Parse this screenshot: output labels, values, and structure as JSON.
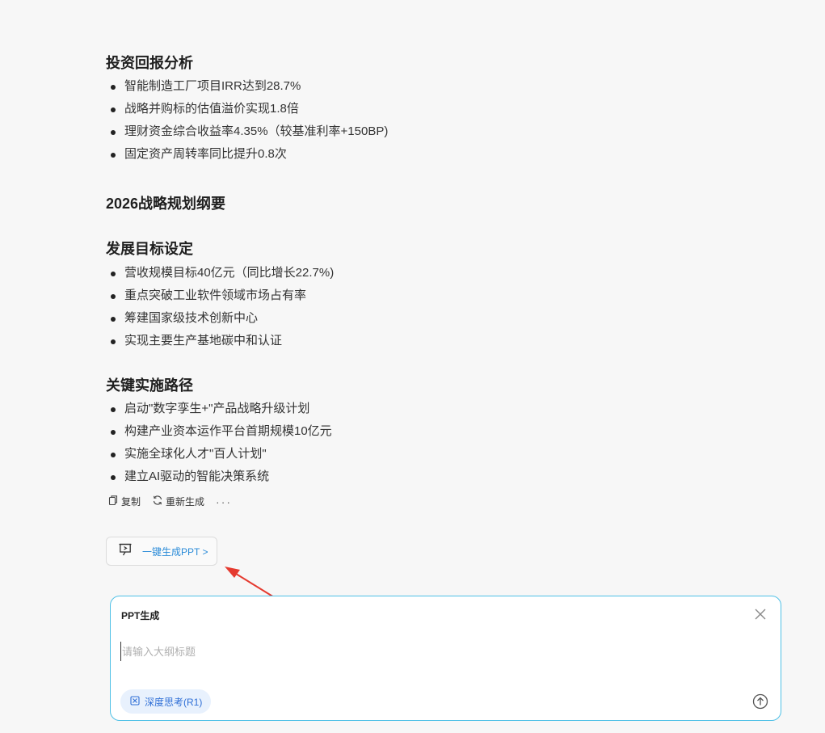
{
  "sections": [
    {
      "title": "投资回报分析",
      "items": [
        "智能制造工厂项目IRR达到28.7%",
        "战略并购标的估值溢价实现1.8倍",
        "理财资金综合收益率4.35%（较基准利率+150BP)",
        "固定资产周转率同比提升0.8次"
      ]
    },
    {
      "title": "2026战略规划纲要",
      "items": []
    },
    {
      "title": "发展目标设定",
      "items": [
        "营收规模目标40亿元（同比增长22.7%)",
        "重点突破工业软件领域市场占有率",
        "筹建国家级技术创新中心",
        "实现主要生产基地碳中和认证"
      ]
    },
    {
      "title": "关键实施路径",
      "items": [
        "启动\"数字孪生+\"产品战略升级计划",
        "构建产业资本运作平台首期规模10亿元",
        "实施全球化人才\"百人计划\"",
        "建立AI驱动的智能决策系统"
      ]
    }
  ],
  "actions": {
    "copy_label": "复制",
    "regenerate_label": "重新生成",
    "more_label": "···"
  },
  "ppt_button": {
    "label": "一键生成PPT >"
  },
  "panel": {
    "title": "PPT生成",
    "input_placeholder": "请输入大纲标题",
    "input_value": "",
    "think_label": "深度思考(R1)"
  },
  "colors": {
    "accent": "#2a8bd8",
    "panel_border": "#4fc0e6",
    "arrow": "#e53a2f",
    "think_bg": "#e8f1fd"
  },
  "icons": {
    "copy": "copy-icon",
    "regenerate": "refresh-icon",
    "ppt": "presentation-icon",
    "close": "close-icon",
    "think": "atom-icon",
    "send": "arrow-up-circle-icon"
  }
}
